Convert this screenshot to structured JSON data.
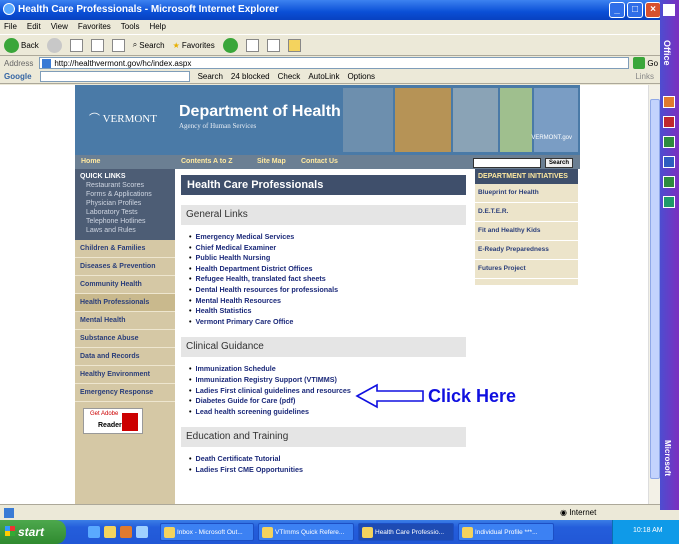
{
  "window": {
    "title": "Health Care Professionals - Microsoft Internet Explorer"
  },
  "menu": [
    "File",
    "Edit",
    "View",
    "Favorites",
    "Tools",
    "Help"
  ],
  "toolbar": {
    "back": "Back",
    "search": "Search",
    "favorites": "Favorites"
  },
  "address": {
    "label": "Address",
    "url": "http://healthvermont.gov/hc/index.aspx",
    "go": "Go",
    "links": "Links"
  },
  "google": {
    "logo": "Google",
    "search": "Search",
    "blocked": "24 blocked",
    "check": "Check",
    "autolink": "AutoLink",
    "options": "Options"
  },
  "officebar": {
    "label": "Office",
    "brand": "Microsoft"
  },
  "site": {
    "brand_vermont": "VERMONT",
    "dept_title": "Department of Health",
    "agency": "Agency of Human Services",
    "vtgov": "VERMONT.gov",
    "nav": [
      "Home",
      "Contents A to Z",
      "Site Map",
      "Contact Us"
    ],
    "search_btn": "Search",
    "quick_links_heading": "QUICK LINKS",
    "quick_links": [
      "Restaurant Scores",
      "Forms & Applications",
      "Physician Profiles",
      "Laboratory Tests",
      "Telephone Hotlines",
      "Laws and Rules"
    ],
    "left_nav": [
      "Children & Families",
      "Diseases & Prevention",
      "Community Health",
      "Health Professionals",
      "Mental Health",
      "Substance Abuse",
      "Data and Records",
      "Healthy Environment",
      "Emergency Response"
    ],
    "adobe": {
      "get": "Get Adobe",
      "reader": "Reader"
    },
    "page_title": "Health Care Professionals",
    "sections": [
      {
        "heading": "General Links",
        "items": [
          "Emergency Medical Services",
          "Chief Medical Examiner",
          "Public Health Nursing",
          "Health Department District Offices",
          "Refugee Health, translated fact sheets",
          "Dental Health resources for professionals",
          "Mental Health Resources",
          "Health Statistics",
          "Vermont Primary Care Office"
        ]
      },
      {
        "heading": "Clinical Guidance",
        "items": [
          "Immunization Schedule",
          "Immunization Registry Support (VTIMMS)",
          "Ladies First clinical guidelines and resources",
          "Diabetes Guide for Care (pdf)",
          "Lead health screening guidelines"
        ]
      },
      {
        "heading": "Education and Training",
        "items": [
          "Death Certificate Tutorial",
          "Ladies First CME Opportunities"
        ]
      }
    ],
    "initiatives_heading": "DEPARTMENT INITIATIVES",
    "initiatives": [
      "Blueprint for Health",
      "D.E.T.E.R.",
      "Fit and Healthy Kids",
      "E-Ready Preparedness",
      "Futures Project"
    ]
  },
  "annotation": {
    "text": "Click Here",
    "color": "#1010e0"
  },
  "status": {
    "zone": "Internet"
  },
  "taskbar": {
    "start": "start",
    "tasks": [
      "Inbox - Microsoft Out...",
      "VTImms Quick Refere...",
      "Health Care Professio...",
      "Individual Profile ***..."
    ],
    "clock": "10:18 AM"
  },
  "colors": {
    "ie_blue": "#0a4fd6",
    "site_banner": "#4a7aa7",
    "nav_dark": "#3f4f6b",
    "leftnav_tan": "#d5c8a5"
  }
}
